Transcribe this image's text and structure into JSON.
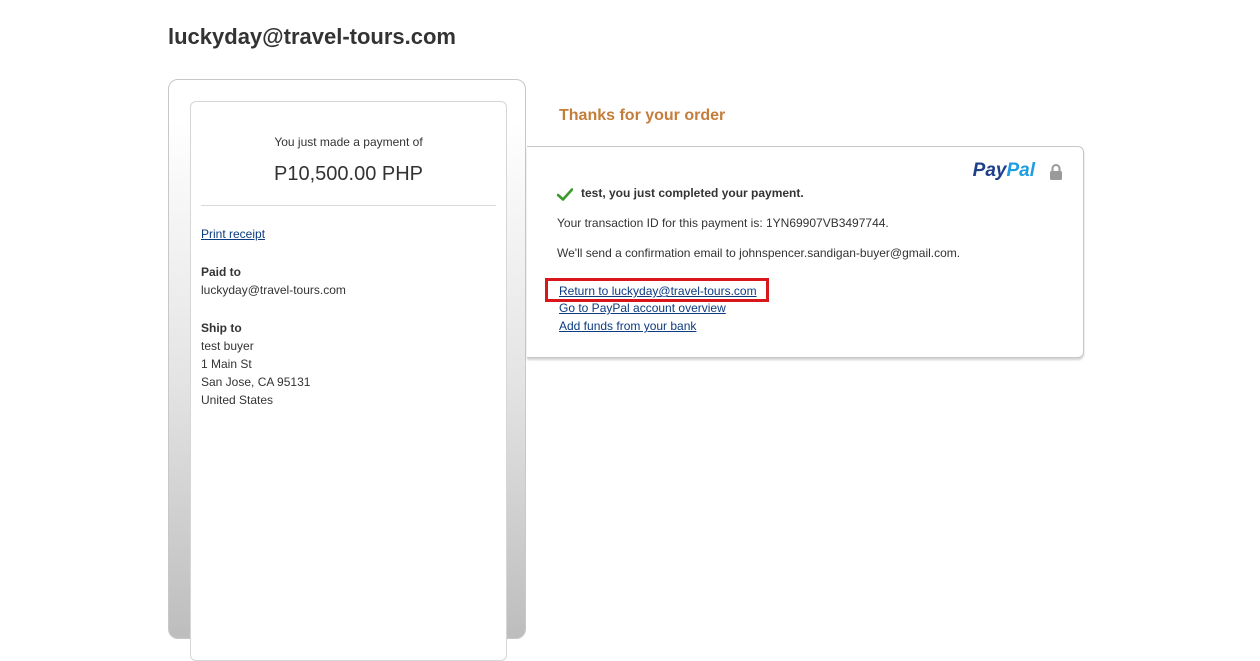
{
  "merchant": {
    "title": "luckyday@travel-tours.com"
  },
  "summary": {
    "payment_label": "You just made a payment of",
    "amount": "P10,500.00 PHP",
    "print_receipt": "Print receipt",
    "paid_to": {
      "heading": "Paid to",
      "value": "luckyday@travel-tours.com"
    },
    "ship_to": {
      "heading": "Ship to",
      "lines": [
        "test buyer",
        "1 Main St",
        "San Jose, CA 95131",
        "United States"
      ]
    }
  },
  "confirmation": {
    "thanks_heading": "Thanks for your order",
    "logo": {
      "part1": "Pay",
      "part2": "Pal"
    },
    "success_message": "test, you just completed your payment.",
    "transaction_text": "Your transaction ID for this payment is: 1YN69907VB3497744.",
    "email_text": "We'll send a confirmation email to johnspencer.sandigan-buyer@gmail.com.",
    "links": {
      "return": "Return to luckyday@travel-tours.com",
      "overview": "Go to PayPal account overview",
      "add_funds": "Add funds from your bank"
    }
  },
  "colors": {
    "thanks_heading": "#c47d3a",
    "link": "#0c3b80",
    "highlight_border": "#d9161c",
    "paypal_dark": "#1e3f8a",
    "paypal_light": "#1e9ee0",
    "check": "#3a9a2a"
  },
  "icons": {
    "check": "check-icon",
    "lock": "lock-icon"
  }
}
